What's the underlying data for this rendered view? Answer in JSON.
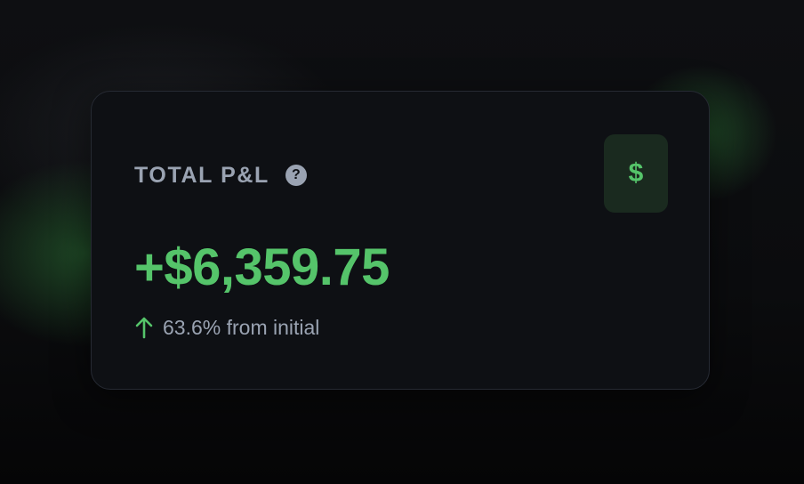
{
  "card": {
    "label": "TOTAL P&L",
    "help_icon": "question-circle-icon",
    "help_glyph": "?",
    "badge_icon": "dollar-icon",
    "badge_glyph": "$",
    "value": "+$6,359.75",
    "change_icon": "arrow-up-icon",
    "change_text": "63.6% from initial"
  },
  "colors": {
    "positive": "#55c46a",
    "muted_text": "#9aa3b2",
    "card_bg": "#0e1014",
    "badge_bg": "#1a2a1f",
    "card_border": "#262a33"
  }
}
